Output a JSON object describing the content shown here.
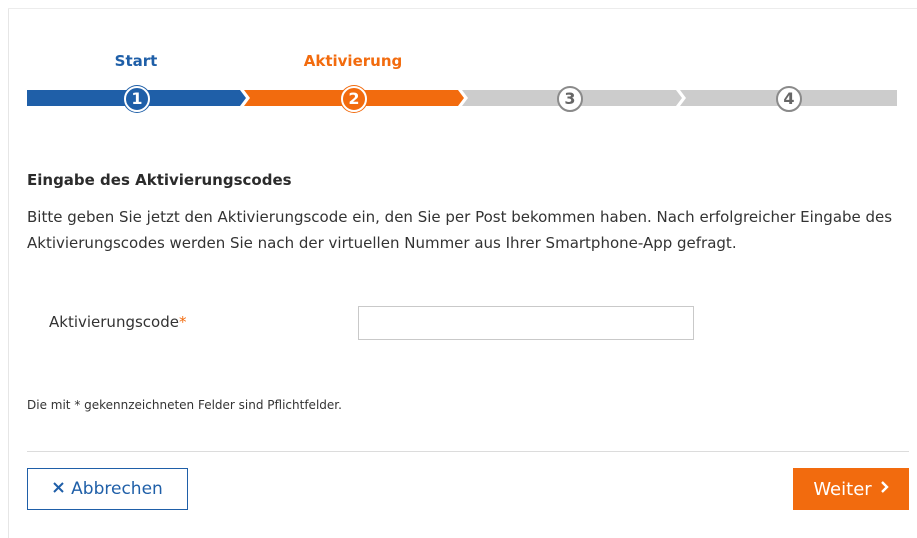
{
  "stepper": {
    "steps": [
      {
        "label": "Start",
        "number": "1",
        "state": "done"
      },
      {
        "label": "Aktivierung",
        "number": "2",
        "state": "active"
      },
      {
        "label": "",
        "number": "3",
        "state": "todo"
      },
      {
        "label": "",
        "number": "4",
        "state": "todo"
      }
    ],
    "colors": {
      "done": "#1f5fa8",
      "active": "#f26b0e",
      "todo": "#cccccc"
    }
  },
  "section": {
    "heading": "Eingabe des Aktivierungscodes",
    "description": "Bitte geben Sie jetzt den Aktivierungscode ein, den Sie per Post bekommen haben. Nach erfolgreicher Eingabe des Aktivierungscodes werden Sie nach der virtuellen Nummer aus Ihrer Smartphone-App gefragt."
  },
  "form": {
    "activation_code_label": "Aktivierungscode",
    "required_marker": "*",
    "activation_code_value": "",
    "activation_code_placeholder": ""
  },
  "note": "Die mit * gekennzeichneten Felder sind Pflichtfelder.",
  "actions": {
    "cancel_label": "Abbrechen",
    "cancel_icon": "close-icon",
    "next_label": "Weiter",
    "next_icon": "chevron-right-icon"
  }
}
